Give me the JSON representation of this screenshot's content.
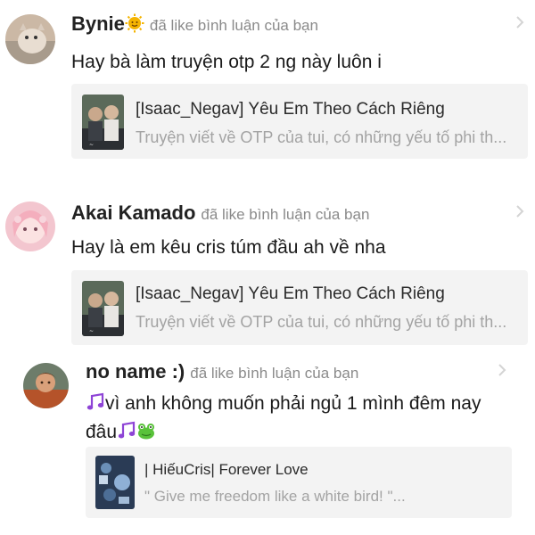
{
  "notifications": [
    {
      "username": "Bynie",
      "username_emoji": "sun-face-icon",
      "action": "đã like bình luận của bạn",
      "comment": "Hay bà làm truyện otp 2 ng này luôn i",
      "story": {
        "title": "[Isaac_Negav] Yêu Em Theo Cách Riêng",
        "description": "Truyện viết về OTP của tui, có những yếu tố phi th..."
      }
    },
    {
      "username": "Akai Kamado",
      "action": "đã like bình luận của bạn",
      "comment": "Hay là em kêu cris túm đầu ah về nha",
      "story": {
        "title": "[Isaac_Negav] Yêu Em Theo Cách Riêng",
        "description": "Truyện viết về OTP của tui, có những yếu tố phi th..."
      }
    },
    {
      "username": "no name :)",
      "action": "đã like bình luận của bạn",
      "comment_line1": "vì anh không muốn phải ngủ 1 mình đêm nay",
      "comment_line2": "đâu",
      "comment_icons": [
        "music-note-icon",
        "music-note-icon",
        "frog-icon"
      ],
      "story": {
        "title": "| HiếuCris| Forever Love",
        "description": "\" Give me freedom like a white bird! \"..."
      }
    }
  ],
  "colors": {
    "card_bg": "#f3f3f3",
    "muted_text": "#8a8a8a",
    "desc_text": "#a3a3a3",
    "music_note": "#8e44d6",
    "frog": "#59c23a"
  }
}
